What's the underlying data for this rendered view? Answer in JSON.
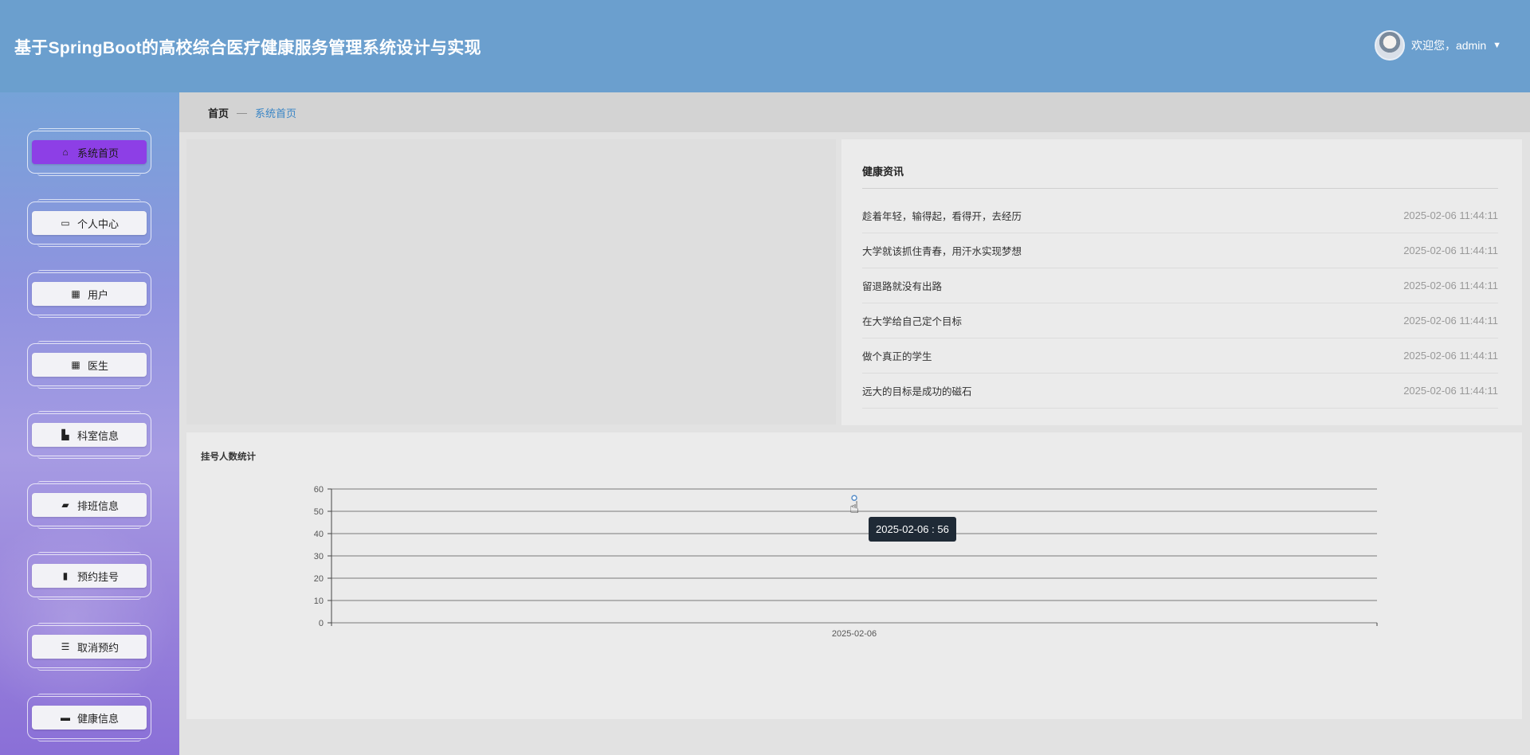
{
  "header": {
    "title": "基于SpringBoot的高校综合医疗健康服务管理系统设计与实现",
    "welcome": "欢迎您，admin"
  },
  "sidebar": {
    "items": [
      {
        "label": "系统首页",
        "icon": "home-icon",
        "active": true
      },
      {
        "label": "个人中心",
        "icon": "profile-icon",
        "active": false
      },
      {
        "label": "用户",
        "icon": "grid-icon",
        "active": false
      },
      {
        "label": "医生",
        "icon": "grid-icon",
        "active": false
      },
      {
        "label": "科室信息",
        "icon": "building-icon",
        "active": false
      },
      {
        "label": "排班信息",
        "icon": "ticket-icon",
        "active": false
      },
      {
        "label": "预约挂号",
        "icon": "bar-chart-icon",
        "active": false
      },
      {
        "label": "取消预约",
        "icon": "list-icon",
        "active": false
      },
      {
        "label": "健康信息",
        "icon": "stack-icon",
        "active": false
      }
    ]
  },
  "breadcrumb": {
    "home": "首页",
    "separator": "—",
    "current": "系统首页"
  },
  "news": {
    "title": "健康资讯",
    "items": [
      {
        "text": "趁着年轻，输得起，看得开，去经历",
        "date": "2025-02-06 11:44:11"
      },
      {
        "text": "大学就该抓住青春，用汗水实现梦想",
        "date": "2025-02-06 11:44:11"
      },
      {
        "text": "留退路就没有出路",
        "date": "2025-02-06 11:44:11"
      },
      {
        "text": "在大学给自己定个目标",
        "date": "2025-02-06 11:44:11"
      },
      {
        "text": "做个真正的学生",
        "date": "2025-02-06 11:44:11"
      },
      {
        "text": "远大的目标是成功的磁石",
        "date": "2025-02-06 11:44:11"
      }
    ]
  },
  "chart_data": {
    "type": "line",
    "title": "挂号人数统计",
    "x": [
      "2025-02-06"
    ],
    "series": [
      {
        "values": [
          56
        ]
      }
    ],
    "ylim": [
      0,
      60
    ],
    "yticks": [
      0,
      10,
      20,
      30,
      40,
      50,
      60
    ],
    "grid": true,
    "tooltip": "2025-02-06 : 56",
    "colors": {
      "line": "#5a8fc8",
      "grid": "#555555"
    }
  }
}
